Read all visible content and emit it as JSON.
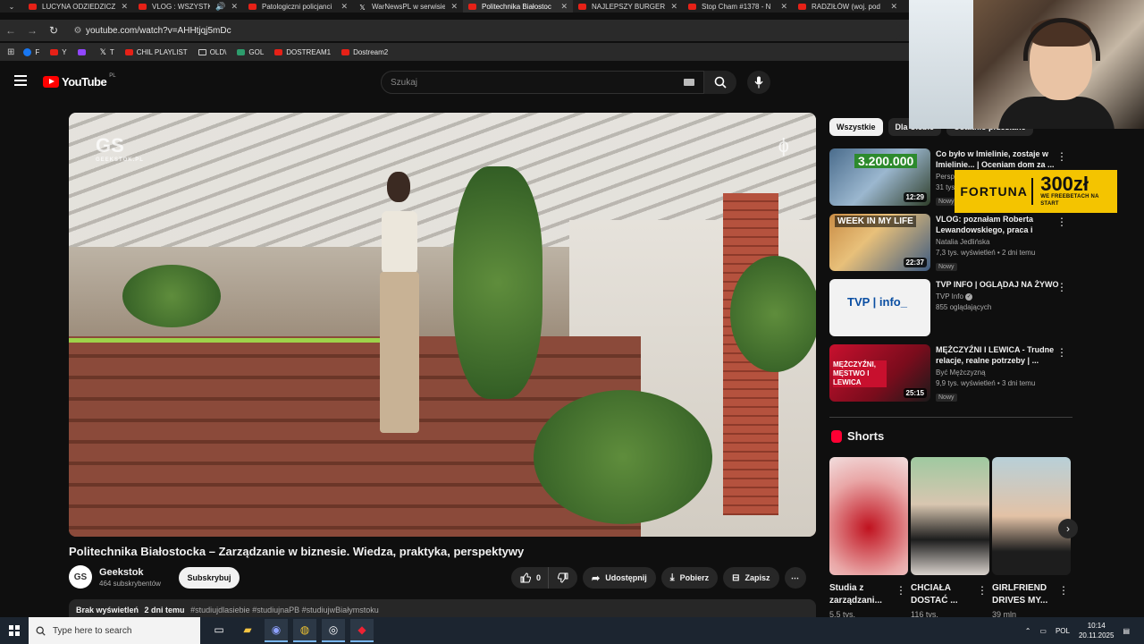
{
  "tabs": [
    {
      "title": "LUCYNA ODZIEDZICZ",
      "icon": "youtube-icon",
      "active": false
    },
    {
      "title": "VLOG : WSZYSTKO",
      "icon": "youtube-icon",
      "active": false,
      "audio": true
    },
    {
      "title": "Patologiczni policjanci",
      "icon": "youtube-icon",
      "active": false
    },
    {
      "title": "WarNewsPL w serwisie",
      "icon": "x-icon",
      "active": false
    },
    {
      "title": "Politechnika Białostoc",
      "icon": "youtube-icon",
      "active": true
    },
    {
      "title": "NAJLEPSZY BURGER",
      "icon": "youtube-icon",
      "active": false
    },
    {
      "title": "Stop Cham #1378 - N",
      "icon": "youtube-icon",
      "active": false
    },
    {
      "title": "RADZIŁÓW (woj. pod",
      "icon": "youtube-icon",
      "active": false
    }
  ],
  "address": {
    "url": "youtube.com/watch?v=AHHtjqj5mDc"
  },
  "bookmarks": [
    {
      "label": "F",
      "icon": "facebook-icon"
    },
    {
      "label": "Y",
      "icon": "youtube-icon"
    },
    {
      "label": "",
      "icon": "twitch-icon"
    },
    {
      "label": "T",
      "icon": "x-icon"
    },
    {
      "label": "CHIL PLAYLIST",
      "icon": "youtube-icon"
    },
    {
      "label": "OLD\\",
      "icon": "folder-icon"
    },
    {
      "label": "GOL",
      "icon": "gol-icon"
    },
    {
      "label": "DOSTREAM1",
      "icon": "youtube-icon"
    },
    {
      "label": "Dostream2",
      "icon": "youtube-icon"
    }
  ],
  "youtube": {
    "logo": "YouTube",
    "country": "PL",
    "search_placeholder": "Szukaj"
  },
  "video": {
    "title": "Politechnika Białostocka – Zarządzanie w biznesie. Wiedza, praktyka, perspektywy",
    "watermark_left": "GS",
    "watermark_left_sub": "GEEKSTOK.PL",
    "watermark_right": "ϕ",
    "channel_initials": "GS",
    "channel": "Geekstok",
    "subscribers": "464 subskrybentów",
    "subscribe_label": "Subskrybuj",
    "likes": "0",
    "share_label": "Udostępnij",
    "download_label": "Pobierz",
    "save_label": "Zapisz",
    "views_label": "Brak wyświetleń",
    "date_label": "2 dni temu",
    "hashtags": "#studiujdlasiebie #studiujnaPB #studiujwBiałymstoku"
  },
  "chips": [
    "Wszystkie",
    "Dla Ciebie",
    "Ostatnio przesłane"
  ],
  "recommendations": [
    {
      "title": "Co było w Imielinie, zostaje w Imielinie... | Oceniam dom za ...",
      "channel": "Perspektywy",
      "views": "31 tys. wyświetleń",
      "badge": "Nowy",
      "duration": "12:29",
      "thumb_text": "3.200.000"
    },
    {
      "title": "VLOG: poznałam Roberta Lewandowskiego, praca i studi...",
      "channel": "Natalia Jedlińska",
      "views": "7,3 tys. wyświetleń • 2 dni temu",
      "badge": "Nowy",
      "duration": "22:37",
      "thumb_text": "WEEK IN MY LIFE"
    },
    {
      "title": "TVP INFO | OGLĄDAJ NA ŻYWO",
      "channel": "TVP Info",
      "views": "855 oglądających",
      "badge": "",
      "duration": "",
      "thumb_text": "TVP | info_"
    },
    {
      "title": "MĘŻCZYŹNI I LEWICA - Trudne relacje, realne potrzeby | ...",
      "channel": "Być Mężczyzną",
      "views": "9,9 tys. wyświetleń • 3 dni temu",
      "badge": "Nowy",
      "duration": "25:15",
      "thumb_text": "MĘŻCZYŹNI, MĘSTWO I LEWICA"
    }
  ],
  "shorts": {
    "heading": "Shorts",
    "items": [
      {
        "title": "Studia z zarządzani...",
        "views": "5,5 tys."
      },
      {
        "title": "CHCIAŁA DOSTAĆ ...",
        "views": "116 tys."
      },
      {
        "title": "GIRLFRIEND DRIVES MY...",
        "views": "39 mln"
      }
    ]
  },
  "ad": {
    "brand": "FORTUNA",
    "amount": "300zł",
    "subtitle": "WE FREEBETACH NA START"
  },
  "taskbar": {
    "search_placeholder": "Type here to search",
    "lang": "POL",
    "time": "10:14",
    "date": "20.11.2025"
  }
}
